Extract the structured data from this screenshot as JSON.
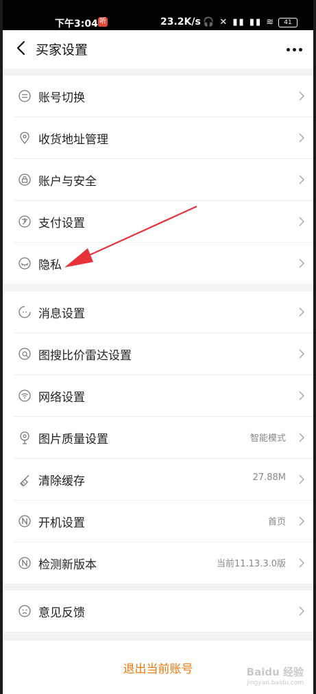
{
  "status_bar": {
    "time": "下午3:04",
    "badge": "听",
    "speed": "23.2K/s",
    "battery": "41"
  },
  "header": {
    "title": "买家设置"
  },
  "group1": [
    {
      "label": "账号切换",
      "icon": "switch-icon"
    },
    {
      "label": "收货地址管理",
      "icon": "location-icon"
    },
    {
      "label": "账户与安全",
      "icon": "lock-icon"
    },
    {
      "label": "支付设置",
      "icon": "pay-icon"
    },
    {
      "label": "隐私",
      "icon": "eye-icon"
    }
  ],
  "group2": [
    {
      "label": "消息设置",
      "icon": "message-icon",
      "value": ""
    },
    {
      "label": "图搜比价雷达设置",
      "icon": "radar-icon",
      "value": ""
    },
    {
      "label": "网络设置",
      "icon": "wifi-icon",
      "value": ""
    },
    {
      "label": "图片质量设置",
      "icon": "image-quality-icon",
      "value": "智能模式"
    },
    {
      "label": "清除缓存",
      "icon": "broom-icon",
      "value": "27.88M"
    },
    {
      "label": "开机设置",
      "icon": "startup-icon",
      "value": "首页"
    },
    {
      "label": "检测新版本",
      "icon": "version-icon",
      "value": "当前11.13.3.0版"
    }
  ],
  "group3": [
    {
      "label": "意见反馈",
      "icon": "feedback-icon"
    }
  ],
  "logout": {
    "label": "退出当前账号"
  },
  "watermark": {
    "brand": "Baidu 经验",
    "url": "jingyan.baidu.com"
  },
  "colors": {
    "accent": "#f07a0c",
    "arrow": "#e8323a"
  }
}
